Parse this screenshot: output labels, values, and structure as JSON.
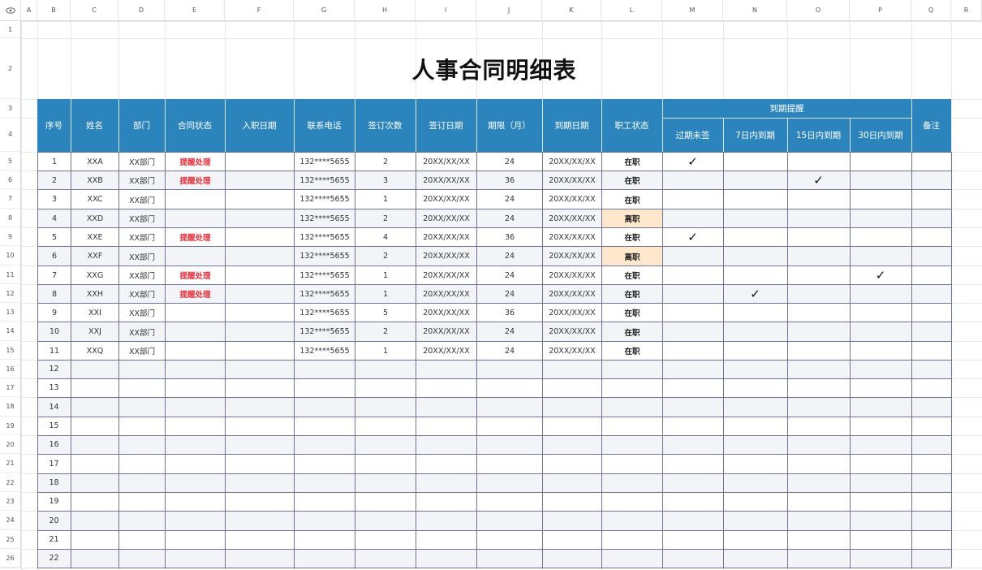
{
  "sheet": {
    "title": "人事合同明细表",
    "column_letters": [
      "A",
      "B",
      "C",
      "D",
      "E",
      "F",
      "G",
      "H",
      "I",
      "J",
      "K",
      "L",
      "M",
      "N",
      "O",
      "P",
      "Q",
      "R"
    ],
    "row_numbers": [
      1,
      2,
      3,
      4,
      5,
      6,
      7,
      8,
      9,
      10,
      11,
      12,
      13,
      14,
      15,
      16,
      17,
      18,
      19,
      20,
      21,
      22,
      23,
      24,
      25,
      26
    ],
    "select_all_icon": "eye-icon",
    "headers": [
      "序号",
      "姓名",
      "部门",
      "合同状态",
      "入职日期",
      "联系电话",
      "签订次数",
      "签订日期",
      "期限（月）",
      "到期日期",
      "职工状态"
    ],
    "reminder_header": "到期提醒",
    "reminder_subheaders": [
      "过期未签",
      "7日内到期",
      "15日内到期",
      "30日内到期"
    ],
    "remarks_header": "备注",
    "check_mark": "✓",
    "rows": [
      {
        "no": "1",
        "name": "XXA",
        "dept": "XX部门",
        "contract_status": "提醒处理",
        "entry_date": "",
        "phone": "132****5655",
        "sign_count": "2",
        "sign_date": "20XX/XX/XX",
        "term": "24",
        "due_date": "20XX/XX/XX",
        "staff_status": "在职",
        "reminder": 0
      },
      {
        "no": "2",
        "name": "XXB",
        "dept": "XX部门",
        "contract_status": "提醒处理",
        "entry_date": "",
        "phone": "132****5655",
        "sign_count": "3",
        "sign_date": "20XX/XX/XX",
        "term": "36",
        "due_date": "20XX/XX/XX",
        "staff_status": "在职",
        "reminder": 2
      },
      {
        "no": "3",
        "name": "XXC",
        "dept": "XX部门",
        "contract_status": "",
        "entry_date": "",
        "phone": "132****5655",
        "sign_count": "1",
        "sign_date": "20XX/XX/XX",
        "term": "24",
        "due_date": "20XX/XX/XX",
        "staff_status": "在职",
        "reminder": -1
      },
      {
        "no": "4",
        "name": "XXD",
        "dept": "XX部门",
        "contract_status": "",
        "entry_date": "",
        "phone": "132****5655",
        "sign_count": "2",
        "sign_date": "20XX/XX/XX",
        "term": "24",
        "due_date": "20XX/XX/XX",
        "staff_status": "离职",
        "reminder": -1
      },
      {
        "no": "5",
        "name": "XXE",
        "dept": "XX部门",
        "contract_status": "提醒处理",
        "entry_date": "",
        "phone": "132****5655",
        "sign_count": "4",
        "sign_date": "20XX/XX/XX",
        "term": "36",
        "due_date": "20XX/XX/XX",
        "staff_status": "在职",
        "reminder": 0
      },
      {
        "no": "6",
        "name": "XXF",
        "dept": "XX部门",
        "contract_status": "",
        "entry_date": "",
        "phone": "132****5655",
        "sign_count": "2",
        "sign_date": "20XX/XX/XX",
        "term": "24",
        "due_date": "20XX/XX/XX",
        "staff_status": "离职",
        "reminder": -1
      },
      {
        "no": "7",
        "name": "XXG",
        "dept": "XX部门",
        "contract_status": "提醒处理",
        "entry_date": "",
        "phone": "132****5655",
        "sign_count": "1",
        "sign_date": "20XX/XX/XX",
        "term": "24",
        "due_date": "20XX/XX/XX",
        "staff_status": "在职",
        "reminder": 3
      },
      {
        "no": "8",
        "name": "XXH",
        "dept": "XX部门",
        "contract_status": "提醒处理",
        "entry_date": "",
        "phone": "132****5655",
        "sign_count": "1",
        "sign_date": "20XX/XX/XX",
        "term": "24",
        "due_date": "20XX/XX/XX",
        "staff_status": "在职",
        "reminder": 1
      },
      {
        "no": "9",
        "name": "XXI",
        "dept": "XX部门",
        "contract_status": "",
        "entry_date": "",
        "phone": "132****5655",
        "sign_count": "5",
        "sign_date": "20XX/XX/XX",
        "term": "36",
        "due_date": "20XX/XX/XX",
        "staff_status": "在职",
        "reminder": -1
      },
      {
        "no": "10",
        "name": "XXJ",
        "dept": "XX部门",
        "contract_status": "",
        "entry_date": "",
        "phone": "132****5655",
        "sign_count": "2",
        "sign_date": "20XX/XX/XX",
        "term": "24",
        "due_date": "20XX/XX/XX",
        "staff_status": "在职",
        "reminder": -1
      },
      {
        "no": "11",
        "name": "XXQ",
        "dept": "XX部门",
        "contract_status": "",
        "entry_date": "",
        "phone": "132****5655",
        "sign_count": "1",
        "sign_date": "20XX/XX/XX",
        "term": "24",
        "due_date": "20XX/XX/XX",
        "staff_status": "在职",
        "reminder": -1
      }
    ],
    "empty_row_numbers": [
      "12",
      "13",
      "14",
      "15",
      "16",
      "17",
      "18",
      "19",
      "20",
      "21",
      "22"
    ],
    "colors": {
      "header_fill": "#2b84bb",
      "header_text": "#ffffff",
      "status_red": "#e5303b",
      "resigned_fill": "#fde8cd",
      "alt_row_fill": "#f3f4f7",
      "table_border": "#6f7497"
    }
  }
}
